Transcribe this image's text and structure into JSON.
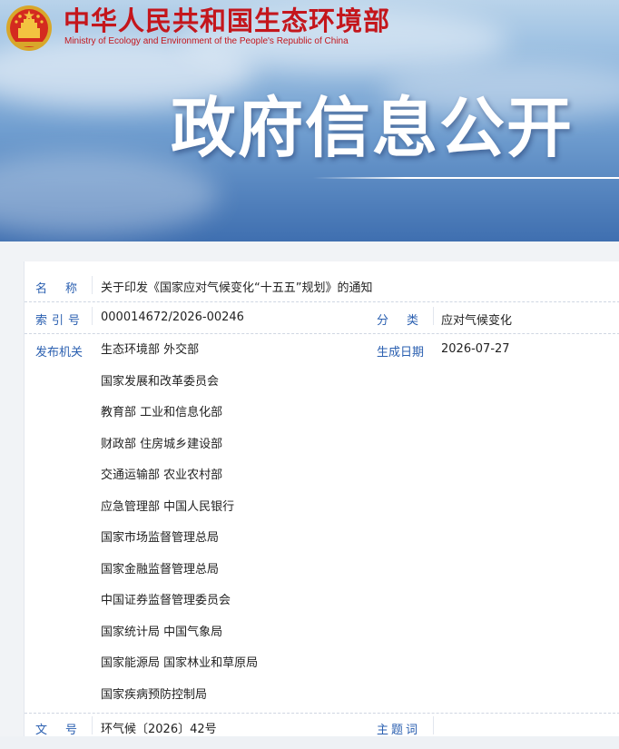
{
  "header": {
    "site_title": "中华人民共和国生态环境部",
    "site_subtitle": "Ministry of Ecology and Environment of the People's Republic of China",
    "section_title": "政府信息公开",
    "colors": {
      "title_red": "#c4161c",
      "label_blue": "#2a5fb0",
      "banner_blue": "#4a7bbf"
    },
    "emblem_icon": "national-emblem-icon"
  },
  "info": {
    "name_label": "名称",
    "name_value": "关于印发《国家应对气候变化“十五五”规划》的通知",
    "index_label": "索引号",
    "index_value": "000014672/2026-00246",
    "category_label": "分类",
    "category_value": "应对气候变化",
    "issuer_label": "发布机关",
    "issuers": [
      "生态环境部 外交部",
      "国家发展和改革委员会",
      "教育部 工业和信息化部",
      "财政部 住房城乡建设部",
      "交通运输部 农业农村部",
      "应急管理部 中国人民银行",
      "国家市场监督管理总局",
      "国家金融监督管理总局",
      "中国证券监督管理委员会",
      "国家统计局 中国气象局",
      "国家能源局 国家林业和草原局",
      "国家疾病预防控制局"
    ],
    "date_label": "生成日期",
    "date_value": "2026-07-27",
    "docno_label": "文号",
    "docno_value": "环气候〔2026〕42号",
    "keywords_label": "主题词",
    "keywords_value": ""
  }
}
